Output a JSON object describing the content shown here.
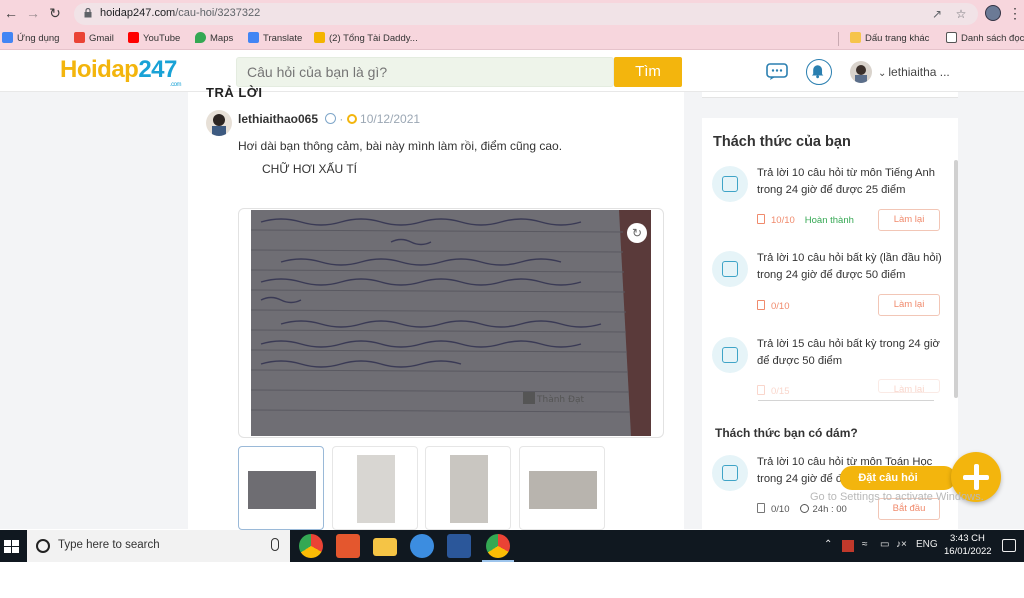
{
  "browser": {
    "url_host": "hoidap247.com",
    "url_path": "/cau-hoi/3237322",
    "bookmarks": [
      {
        "label": "Ứng dụng",
        "icon": "apps-grid-icon",
        "color": "#4285f4"
      },
      {
        "label": "Gmail",
        "icon": "gmail-icon",
        "color": "#ea4335"
      },
      {
        "label": "YouTube",
        "icon": "youtube-icon",
        "color": "#ff0000"
      },
      {
        "label": "Maps",
        "icon": "maps-pin-icon",
        "color": "#34a853"
      },
      {
        "label": "Translate",
        "icon": "translate-icon",
        "color": "#4285f4"
      },
      {
        "label": "(2) Tổng Tài Daddy...",
        "icon": "site-icon",
        "color": "#f4b400"
      },
      {
        "label": "Dấu trang khác",
        "icon": "folder-icon",
        "color": "#f6c44a"
      },
      {
        "label": "Danh sách đọc",
        "icon": "reading-list-icon",
        "color": "#555555"
      }
    ]
  },
  "header": {
    "logo_main": "Hoidap",
    "logo_num": "247",
    "logo_tld": ".com",
    "search_placeholder": "Câu hỏi của bạn là gì?",
    "search_button": "Tìm",
    "username": "lethiaitha ..."
  },
  "answer": {
    "heading": "TRẢ LỜI",
    "username": "lethiaithao065",
    "date": "10/12/2021",
    "line1": "Hơi dài bạn thông cảm, bài này mình làm rồi, điểm cũng cao.",
    "line2": "CHỮ HƠI XẤU TÍ",
    "image_watermark": "Thành Đạt"
  },
  "sidebar": {
    "title": "Thách thức của bạn",
    "challenges": [
      {
        "text": "Trả lời 10 câu hỏi  từ môn Tiếng Anh trong 24 giờ để được 25 điểm",
        "progress": "10/10",
        "status": "Hoàn thành",
        "button": "Làm lại"
      },
      {
        "text": "Trả lời 10 câu hỏi  bất kỳ (lần đầu hỏi) trong 24 giờ để được 50 điểm",
        "progress": "0/10",
        "status": "",
        "button": "Làm lại"
      },
      {
        "text": "Trả lời 15 câu hỏi  bất kỳ  trong 24 giờ để được 50 điểm",
        "progress": "0/15",
        "status": "",
        "button": "Làm lại"
      }
    ],
    "dare_title": "Thách thức bạn có dám?",
    "dare": {
      "text": "Trả lời 10 câu hỏi  từ môn Toán Học trong 24 giờ để được",
      "progress": "0/10",
      "time": "24h : 00",
      "button": "Bắt đầu"
    },
    "ask_label": "Đặt câu hỏi",
    "activate_watermark": "Go to Settings to activate Windows."
  },
  "taskbar": {
    "search_placeholder": "Type here to search",
    "lang": "ENG",
    "time": "3:43 CH",
    "date": "16/01/2022"
  },
  "colors": {
    "brand_yellow": "#f3b50d",
    "brand_blue": "#19a2d6",
    "accent_orange": "#f08a6c",
    "success_green": "#35a853"
  }
}
